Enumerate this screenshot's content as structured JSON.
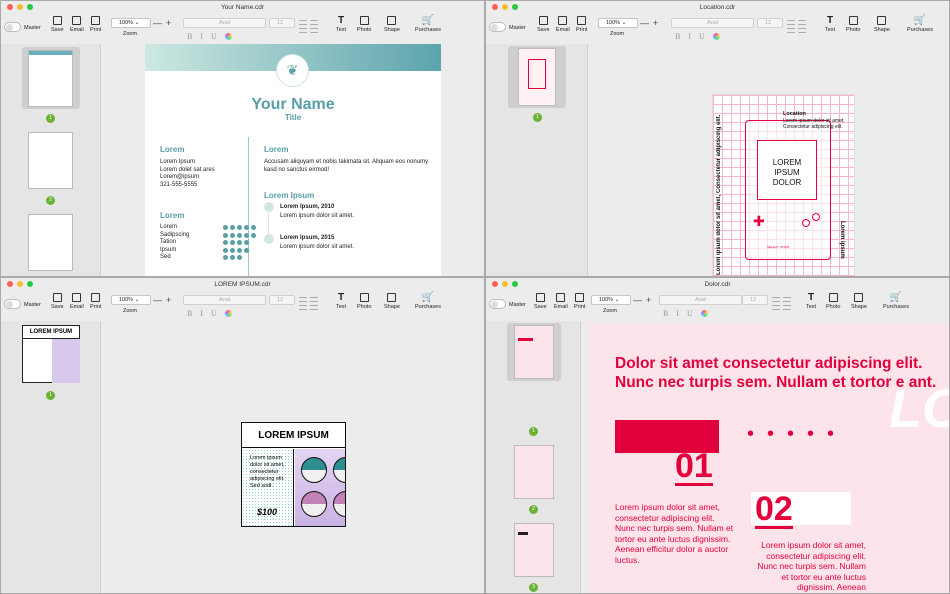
{
  "toolbar": {
    "master": "Master",
    "save": "Save",
    "email": "Email",
    "print": "Print",
    "zoom_value": "100%",
    "zoom": "Zoom",
    "font": "Arial",
    "size": "12",
    "bold": "B",
    "italic": "I",
    "underline": "U",
    "text": "Text",
    "photo": "Photo",
    "shape": "Shape",
    "purchases": "Purchases"
  },
  "colors": {
    "teal": "#5a9ea6",
    "pink": "#e2003c",
    "purchase_blue": "#2f80ed",
    "badge_green": "#6bb234"
  },
  "windows": [
    {
      "title": "Your Name.cdr",
      "pages": [
        "1",
        "2",
        "3"
      ]
    },
    {
      "title": "Location.cdr",
      "pages": [
        "1"
      ]
    },
    {
      "title": "LOREM IPSUM.cdr",
      "pages": [
        "1"
      ]
    },
    {
      "title": "Dolor.cdr",
      "pages": [
        "1",
        "2",
        "3"
      ]
    }
  ],
  "resume": {
    "name": "Your Name",
    "title": "Title",
    "contact_heading": "Lorem",
    "contact": [
      "Lorem Ipsum",
      "Lorem dolet sat ares",
      "Lorem@ipsum",
      "321-555-5555"
    ],
    "about_heading": "Lorem",
    "about": "Accusam aliquyam et nobis takimata sit. Aliquam eos nonumy kasd no sanctus eirmod!",
    "skills_heading": "Lorem",
    "skills": [
      "Lorem",
      "Sadipscing",
      "Tation",
      "Ipsum",
      "Sed"
    ],
    "skill_levels": [
      5,
      5,
      4,
      4,
      3
    ],
    "exp_heading": "Lorem Ipsum",
    "exp": [
      {
        "h": "Lorem Ipsum, 2010",
        "t": "Lorem ipsum dolor sit amet."
      },
      {
        "h": "Lorem Ipsum, 2015",
        "t": "Lorem ipsum dolor sit amet."
      }
    ]
  },
  "location": {
    "heading": "Location",
    "body": "Lorem ipsum dolor sit amet. Consectetur adipiscing elit.",
    "screen": "LOREM IPSUM DOLOR",
    "side_left": "Lorem ipsum dolor sit amet, Consectetur adipiscing elit.",
    "side_right": "Lorem ipsum",
    "select": "SELECT",
    "start": "START"
  },
  "flyer": {
    "title": "LOREM IPSUM",
    "body": "Lorem ipsum dolor sit amet, consectetur adipiscing elit. Sed sodi.",
    "price": "$100"
  },
  "dolor": {
    "headline": "Dolor sit amet consectetur adipiscing elit. Nunc nec turpis sem. Nullam et tortor e ant.",
    "n1": "01",
    "n2": "02",
    "p1": "Lorem ipsum dolor sit amet, consectetur adipiscing elit. Nunc nec turpis sem. Nullam et tortor eu ante luctus dignissim. Aenean efficitur dolor a auctor luctus.",
    "p2": "Lorem ipsum dolor sit amet, consectetur adipiscing elit. Nunc nec turpis sem. Nullam et tortor eu ante luctus dignissim. Aenean",
    "big": "LOREM"
  }
}
